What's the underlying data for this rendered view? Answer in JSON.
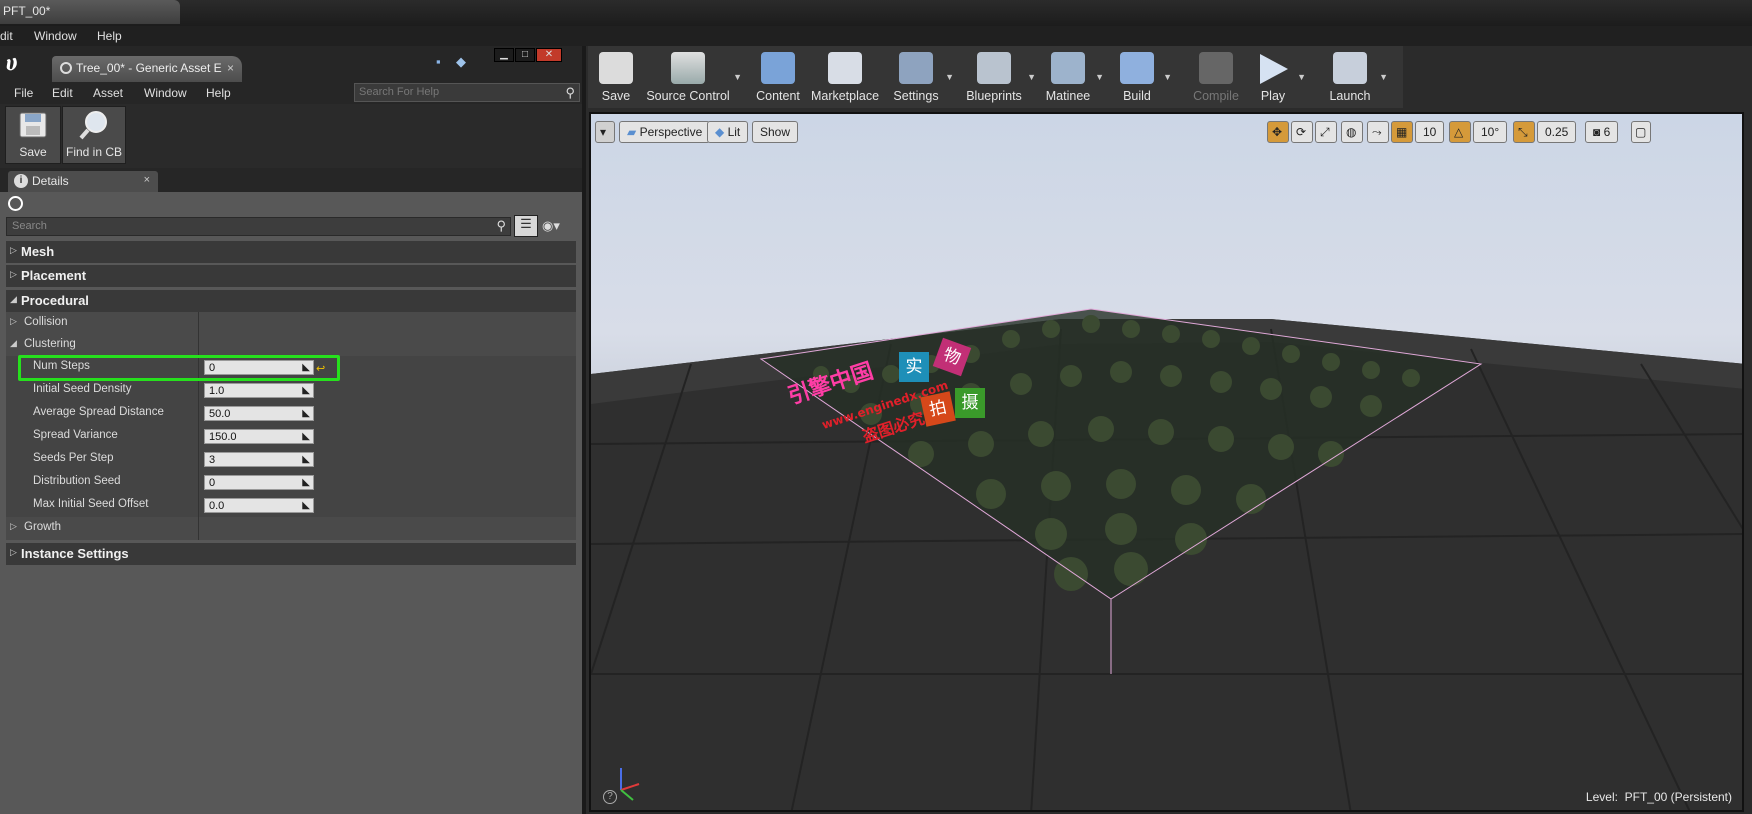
{
  "titlebar": {
    "doc_tab": "PFT_00*"
  },
  "global_menu": [
    "dit",
    "Window",
    "Help"
  ],
  "asset_editor": {
    "tab_title": "Tree_00* - Generic Asset E",
    "menu": [
      "File",
      "Edit",
      "Asset",
      "Window",
      "Help"
    ],
    "help_search_placeholder": "Search For Help",
    "toolbar": {
      "save": "Save",
      "find_in_cb": "Find in CB"
    },
    "details_tab": "Details",
    "details_search_placeholder": "Search",
    "categories": {
      "mesh": "Mesh",
      "placement": "Placement",
      "procedural": "Procedural",
      "collision": "Collision",
      "clustering": "Clustering",
      "growth": "Growth",
      "instance_settings": "Instance Settings"
    },
    "properties": [
      {
        "name": "Num Steps",
        "value": "0"
      },
      {
        "name": "Initial Seed Density",
        "value": "1.0"
      },
      {
        "name": "Average Spread Distance",
        "value": "50.0"
      },
      {
        "name": "Spread Variance",
        "value": "150.0"
      },
      {
        "name": "Seeds Per Step",
        "value": "3"
      },
      {
        "name": "Distribution Seed",
        "value": "0"
      },
      {
        "name": "Max Initial Seed Offset",
        "value": "0.0"
      }
    ]
  },
  "level_editor": {
    "toolbar": [
      "Save",
      "Source Control",
      "Content",
      "Marketplace",
      "Settings",
      "Blueprints",
      "Matinee",
      "Build",
      "Compile",
      "Play",
      "Launch"
    ],
    "viewport": {
      "perspective": "Perspective",
      "lit": "Lit",
      "show": "Show",
      "grid_snap": "10",
      "rotation_snap": "10°",
      "scale_snap": "0.25",
      "camera_speed": "6",
      "level_label": "Level:",
      "level_name": "PFT_00 (Persistent)"
    },
    "watermark": {
      "site_name": "引擎中国",
      "url": "www.enginedx.com",
      "slogan": "盗图必究",
      "chars": [
        "实",
        "物",
        "拍",
        "摄"
      ]
    }
  },
  "colors": {
    "highlight": "#26e01d",
    "accent_orange": "#d59a3a"
  }
}
